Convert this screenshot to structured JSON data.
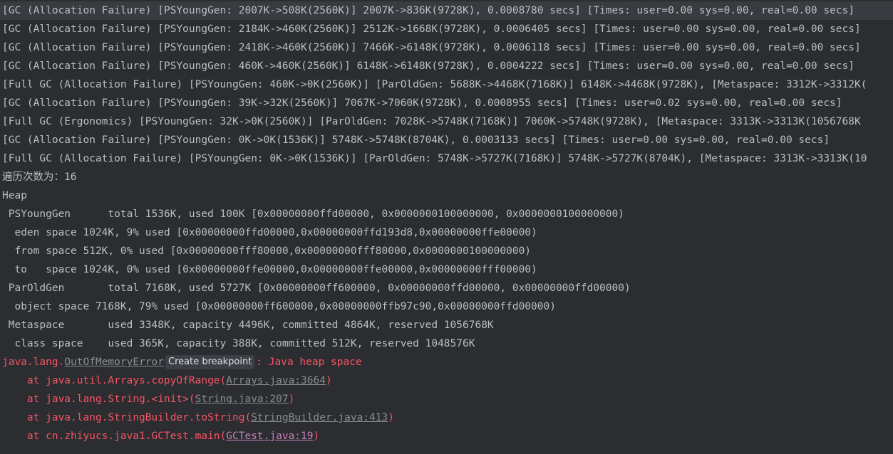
{
  "colors": {
    "background": "#2b2d30",
    "text": "#bcbec4",
    "error": "#f75464",
    "link": "#8a8d93",
    "visited_link": "#c77dbb",
    "highlight_row": "#393b40"
  },
  "gc_log": [
    "[GC (Allocation Failure) [PSYoungGen: 2007K->508K(2560K)] 2007K->836K(9728K), 0.0008780 secs] [Times: user=0.00 sys=0.00, real=0.00 secs]",
    "[GC (Allocation Failure) [PSYoungGen: 2184K->460K(2560K)] 2512K->1668K(9728K), 0.0006405 secs] [Times: user=0.00 sys=0.00, real=0.00 secs]",
    "[GC (Allocation Failure) [PSYoungGen: 2418K->460K(2560K)] 7466K->6148K(9728K), 0.0006118 secs] [Times: user=0.00 sys=0.00, real=0.00 secs]",
    "[GC (Allocation Failure) [PSYoungGen: 460K->460K(2560K)] 6148K->6148K(9728K), 0.0004222 secs] [Times: user=0.00 sys=0.00, real=0.00 secs]",
    "[Full GC (Allocation Failure) [PSYoungGen: 460K->0K(2560K)] [ParOldGen: 5688K->4468K(7168K)] 6148K->4468K(9728K), [Metaspace: 3312K->3312K(",
    "[GC (Allocation Failure) [PSYoungGen: 39K->32K(2560K)] 7067K->7060K(9728K), 0.0008955 secs] [Times: user=0.02 sys=0.00, real=0.00 secs]",
    "[Full GC (Ergonomics) [PSYoungGen: 32K->0K(2560K)] [ParOldGen: 7028K->5748K(7168K)] 7060K->5748K(9728K), [Metaspace: 3313K->3313K(1056768K",
    "[GC (Allocation Failure) [PSYoungGen: 0K->0K(1536K)] 5748K->5748K(8704K), 0.0003133 secs] [Times: user=0.00 sys=0.00, real=0.00 secs]",
    "[Full GC (Allocation Failure) [PSYoungGen: 0K->0K(1536K)] [ParOldGen: 5748K->5727K(7168K)] 5748K->5727K(8704K), [Metaspace: 3313K->3313K(10"
  ],
  "traversal_count": "遍历次数为：16",
  "heap": [
    "Heap",
    " PSYoungGen      total 1536K, used 100K [0x00000000ffd00000, 0x0000000100000000, 0x0000000100000000)",
    "  eden space 1024K, 9% used [0x00000000ffd00000,0x00000000ffd193d8,0x00000000ffe00000)",
    "  from space 512K, 0% used [0x00000000fff80000,0x00000000fff80000,0x0000000100000000)",
    "  to   space 1024K, 0% used [0x00000000ffe00000,0x00000000ffe00000,0x00000000fff00000)",
    " ParOldGen       total 7168K, used 5727K [0x00000000ff600000, 0x00000000ffd00000, 0x00000000ffd00000)",
    "  object space 7168K, 79% used [0x00000000ff600000,0x00000000ffb97c90,0x00000000ffd00000)",
    " Metaspace       used 3348K, capacity 4496K, committed 4864K, reserved 1056768K",
    "  class space    used 365K, capacity 388K, committed 512K, reserved 1048576K"
  ],
  "exception": {
    "prefix": "java.lang.",
    "class_link": "OutOfMemoryError",
    "breakpoint_chip": "Create breakpoint",
    "message": ": Java heap space"
  },
  "stack": [
    {
      "pre": "    at java.util.Arrays.copyOfRange(",
      "link": "Arrays.java:3664",
      "post": ")"
    },
    {
      "pre": "    at java.lang.String.<init>(",
      "link": "String.java:207",
      "post": ")"
    },
    {
      "pre": "    at java.lang.StringBuilder.toString(",
      "link": "StringBuilder.java:413",
      "post": ")"
    },
    {
      "pre": "    at cn.zhiyucs.java1.GCTest.main(",
      "link": "GCTest.java:19",
      "post": ")"
    }
  ]
}
